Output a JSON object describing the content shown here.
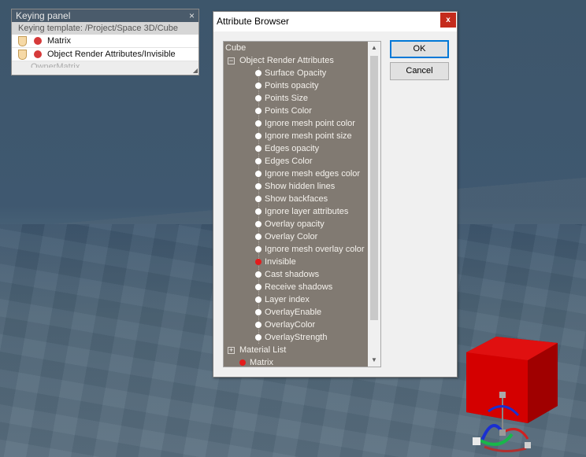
{
  "keying_panel": {
    "title": "Keying panel",
    "close": "×",
    "template": "Keying template: /Project/Space 3D/Cube",
    "rows": [
      {
        "label": "Matrix"
      },
      {
        "label": "Object Render Attributes/Invisible"
      }
    ],
    "cut_row": "OwnerMatrix"
  },
  "dialog": {
    "title": "Attribute Browser",
    "close": "x",
    "ok": "OK",
    "cancel": "Cancel"
  },
  "tree": {
    "root": "Cube",
    "group1": {
      "expander": "−",
      "label": "Object Render Attributes"
    },
    "attributes": [
      {
        "label": "Surface Opacity",
        "marked": false
      },
      {
        "label": "Points opacity",
        "marked": false
      },
      {
        "label": "Points Size",
        "marked": false
      },
      {
        "label": "Points Color",
        "marked": false
      },
      {
        "label": "Ignore mesh point color",
        "marked": false
      },
      {
        "label": "Ignore mesh point size",
        "marked": false
      },
      {
        "label": "Edges opacity",
        "marked": false
      },
      {
        "label": "Edges Color",
        "marked": false
      },
      {
        "label": "Ignore mesh edges color",
        "marked": false
      },
      {
        "label": "Show hidden lines",
        "marked": false
      },
      {
        "label": "Show backfaces",
        "marked": false
      },
      {
        "label": "Ignore layer attributes",
        "marked": false
      },
      {
        "label": "Overlay opacity",
        "marked": false
      },
      {
        "label": "Overlay Color",
        "marked": false
      },
      {
        "label": "Ignore mesh overlay color",
        "marked": false
      },
      {
        "label": "Invisible",
        "marked": true
      },
      {
        "label": "Cast shadows",
        "marked": false
      },
      {
        "label": "Receive shadows",
        "marked": false
      },
      {
        "label": "Layer index",
        "marked": false
      },
      {
        "label": "OverlayEnable",
        "marked": false
      },
      {
        "label": "OverlayColor",
        "marked": false
      },
      {
        "label": "OverlayStrength",
        "marked": false
      }
    ],
    "group2": {
      "expander": "+",
      "label": "Material List"
    },
    "matrix": {
      "label": "Matrix",
      "marked": true
    }
  },
  "colors": {
    "tree_bg": "#817a72",
    "marked_dot": "#e41c1c",
    "cube": "#d40000"
  }
}
